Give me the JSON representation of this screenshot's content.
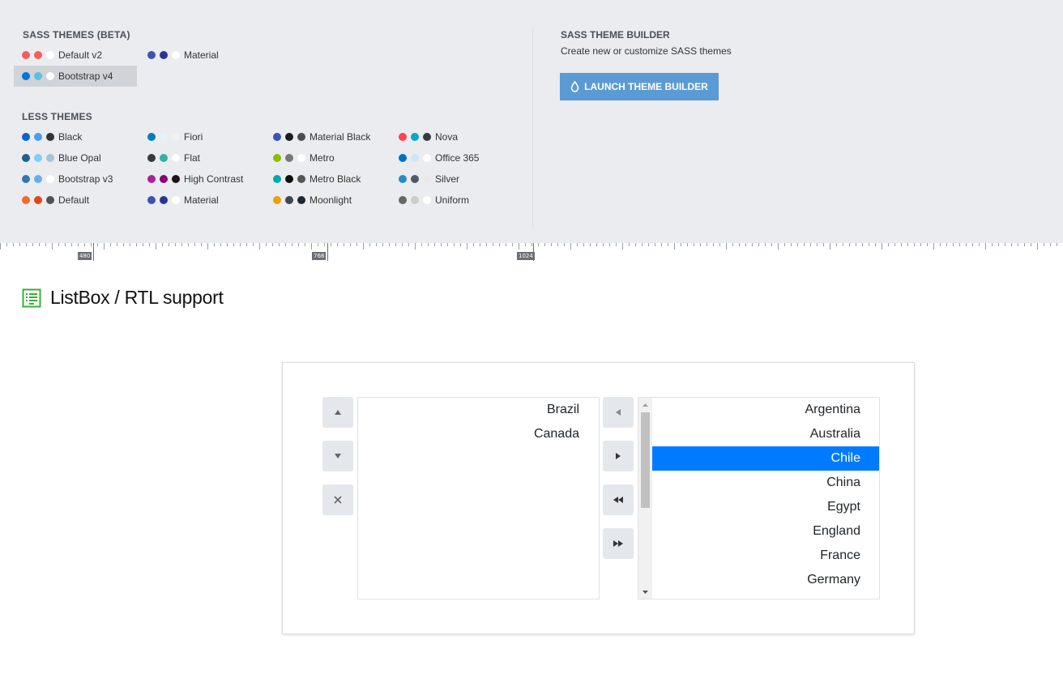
{
  "sass_themes": {
    "title": "SASS THEMES (BETA)",
    "items": [
      {
        "label": "Default v2",
        "colors": [
          "#f35f5a",
          "#f35f5a",
          "#ffffff"
        ],
        "selected": false
      },
      {
        "label": "Material",
        "colors": [
          "#3f51b5",
          "#283593",
          "#ffffff"
        ],
        "selected": false
      },
      {
        "label": "Bootstrap v4",
        "colors": [
          "#0275d8",
          "#5bc0de",
          "#ffffff"
        ],
        "selected": true
      }
    ]
  },
  "less_themes": {
    "title": "LESS THEMES",
    "items": [
      {
        "label": "Black",
        "colors": [
          "#0066cc",
          "#4d9ee6",
          "#333333"
        ]
      },
      {
        "label": "Blue Opal",
        "colors": [
          "#1f5f8b",
          "#7fcff0",
          "#a3c4d6"
        ]
      },
      {
        "label": "Bootstrap v3",
        "colors": [
          "#3276b1",
          "#67afe9",
          "#ffffff"
        ]
      },
      {
        "label": "Default",
        "colors": [
          "#f06c25",
          "#e0451f",
          "#515151"
        ]
      },
      {
        "label": "Fiori",
        "colors": [
          "#007cc0",
          "#e5f2f9",
          "#f2f2f2"
        ]
      },
      {
        "label": "Flat",
        "colors": [
          "#363940",
          "#2eb3a6",
          "#ffffff"
        ]
      },
      {
        "label": "High Contrast",
        "colors": [
          "#b11e9c",
          "#880275",
          "#1b141a"
        ]
      },
      {
        "label": "Material",
        "colors": [
          "#3f51b5",
          "#283593",
          "#ffffff"
        ]
      },
      {
        "label": "Material Black",
        "colors": [
          "#3f51b5",
          "#1c1c1c",
          "#4d4d4d"
        ]
      },
      {
        "label": "Metro",
        "colors": [
          "#8ebc00",
          "#787878",
          "#ffffff"
        ]
      },
      {
        "label": "Metro Black",
        "colors": [
          "#00a8a8",
          "#0e0e0e",
          "#565656"
        ]
      },
      {
        "label": "Moonlight",
        "colors": [
          "#ee9f05",
          "#40444f",
          "#212a33"
        ]
      },
      {
        "label": "Nova",
        "colors": [
          "#ff4350",
          "#00acc1",
          "#363940"
        ]
      },
      {
        "label": "Office 365",
        "colors": [
          "#0072c6",
          "#cde6f7",
          "#ffffff"
        ]
      },
      {
        "label": "Silver",
        "colors": [
          "#298bc8",
          "#515967",
          "#eaeaec"
        ]
      },
      {
        "label": "Uniform",
        "colors": [
          "#666666",
          "#cccccc",
          "#ffffff"
        ]
      }
    ]
  },
  "theme_builder": {
    "title": "SASS THEME BUILDER",
    "description": "Create new or customize SASS themes",
    "button_label": "LAUNCH THEME BUILDER",
    "button_icon": "drop-icon",
    "button_color": "#5b9bd5"
  },
  "ruler": {
    "labels": [
      "480",
      "768",
      "1024"
    ]
  },
  "demo": {
    "title": "ListBox / RTL support",
    "icon": "listbox-icon",
    "icon_color": "#34b233"
  },
  "toolbar": {
    "move_up": "arrow-up-icon",
    "move_down": "arrow-down-icon",
    "remove": "close-icon",
    "transfer_to": "arrow-left-icon",
    "transfer_from": "arrow-right-icon",
    "transfer_all_to": "double-arrow-left-icon",
    "transfer_all_from": "double-arrow-right-icon"
  },
  "listbox_left": {
    "items": [
      "Brazil",
      "Canada"
    ]
  },
  "listbox_right": {
    "items": [
      "Argentina",
      "Australia",
      "Chile",
      "China",
      "Egypt",
      "England",
      "France",
      "Germany"
    ],
    "selected": "Chile",
    "selected_color": "#007bff"
  }
}
